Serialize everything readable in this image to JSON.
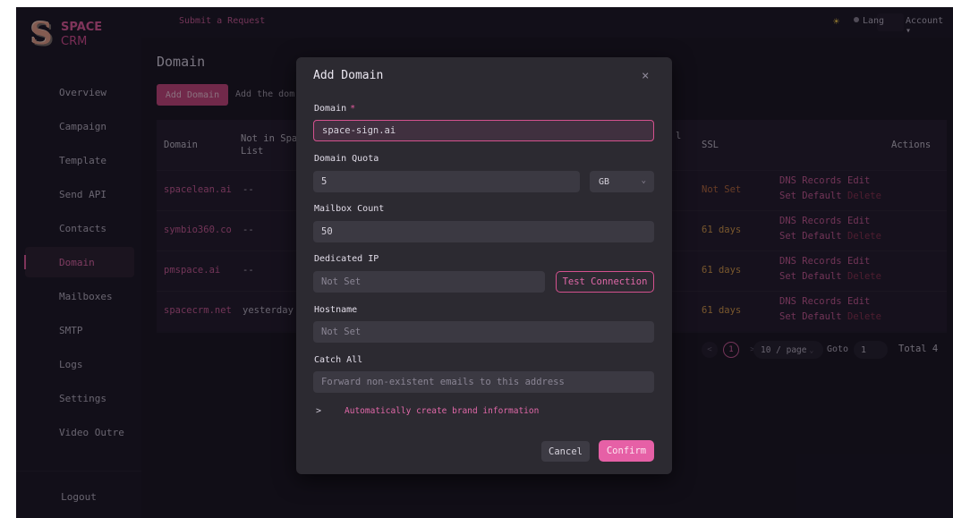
{
  "app": {
    "logo_line1": "SPACE",
    "logo_line2": "CRM",
    "brand_color": "#e05a9c"
  },
  "topbar": {
    "submit_request": "Submit a Request",
    "theme_icon": "sun-icon",
    "lang": "Lang",
    "account": "Account ▾"
  },
  "sidebar": {
    "items": [
      {
        "label": "Overview"
      },
      {
        "label": "Campaign"
      },
      {
        "label": "Template"
      },
      {
        "label": "Send API"
      },
      {
        "label": "Contacts"
      },
      {
        "label": "Domain",
        "active": true
      },
      {
        "label": "Mailboxes"
      },
      {
        "label": "SMTP"
      },
      {
        "label": "Logs"
      },
      {
        "label": "Settings"
      },
      {
        "label": "Video Outre"
      }
    ],
    "logout": "Logout"
  },
  "page": {
    "title": "Domain",
    "add_button": "Add Domain",
    "add_hint": "Add the dom"
  },
  "table": {
    "headers": {
      "domain": "Domain",
      "spam": "Not in Spam List",
      "status_cut": "l",
      "ssl": "SSL",
      "actions": "Actions"
    },
    "rows": [
      {
        "domain": "spacelean.ai",
        "spam": "--",
        "ssl": "Not Set"
      },
      {
        "domain": "symbio360.co",
        "spam": "--",
        "ssl": "61 days"
      },
      {
        "domain": "pmspace.ai",
        "spam": "--",
        "ssl": "61 days"
      },
      {
        "domain": "spacecrm.net",
        "spam": "yesterday",
        "ssl": "61 days"
      }
    ],
    "actions": {
      "dns": "DNS Records",
      "edit": "Edit",
      "set_default": "Set Default",
      "delete": "Delete"
    }
  },
  "pagination": {
    "prev": "<",
    "current_page": "1",
    "next": ">",
    "page_size": "10 / page",
    "goto_label": "Goto",
    "goto_value": "1",
    "total": "Total 4"
  },
  "modal": {
    "title": "Add Domain",
    "close": "×",
    "domain_label": "Domain",
    "required_mark": "*",
    "domain_value": "space-sign.ai",
    "quota_label": "Domain Quota",
    "quota_value": "5",
    "quota_unit": "GB",
    "mailbox_label": "Mailbox Count",
    "mailbox_value": "50",
    "ip_label": "Dedicated IP",
    "ip_placeholder": "Not Set",
    "test_button": "Test Connection",
    "hostname_label": "Hostname",
    "hostname_placeholder": "Not Set",
    "catch_label": "Catch All",
    "catch_placeholder": "Forward non-existent emails to this address",
    "brand_toggle": ">",
    "brand_text": "Automatically create brand information",
    "cancel": "Cancel",
    "confirm": "Confirm"
  }
}
